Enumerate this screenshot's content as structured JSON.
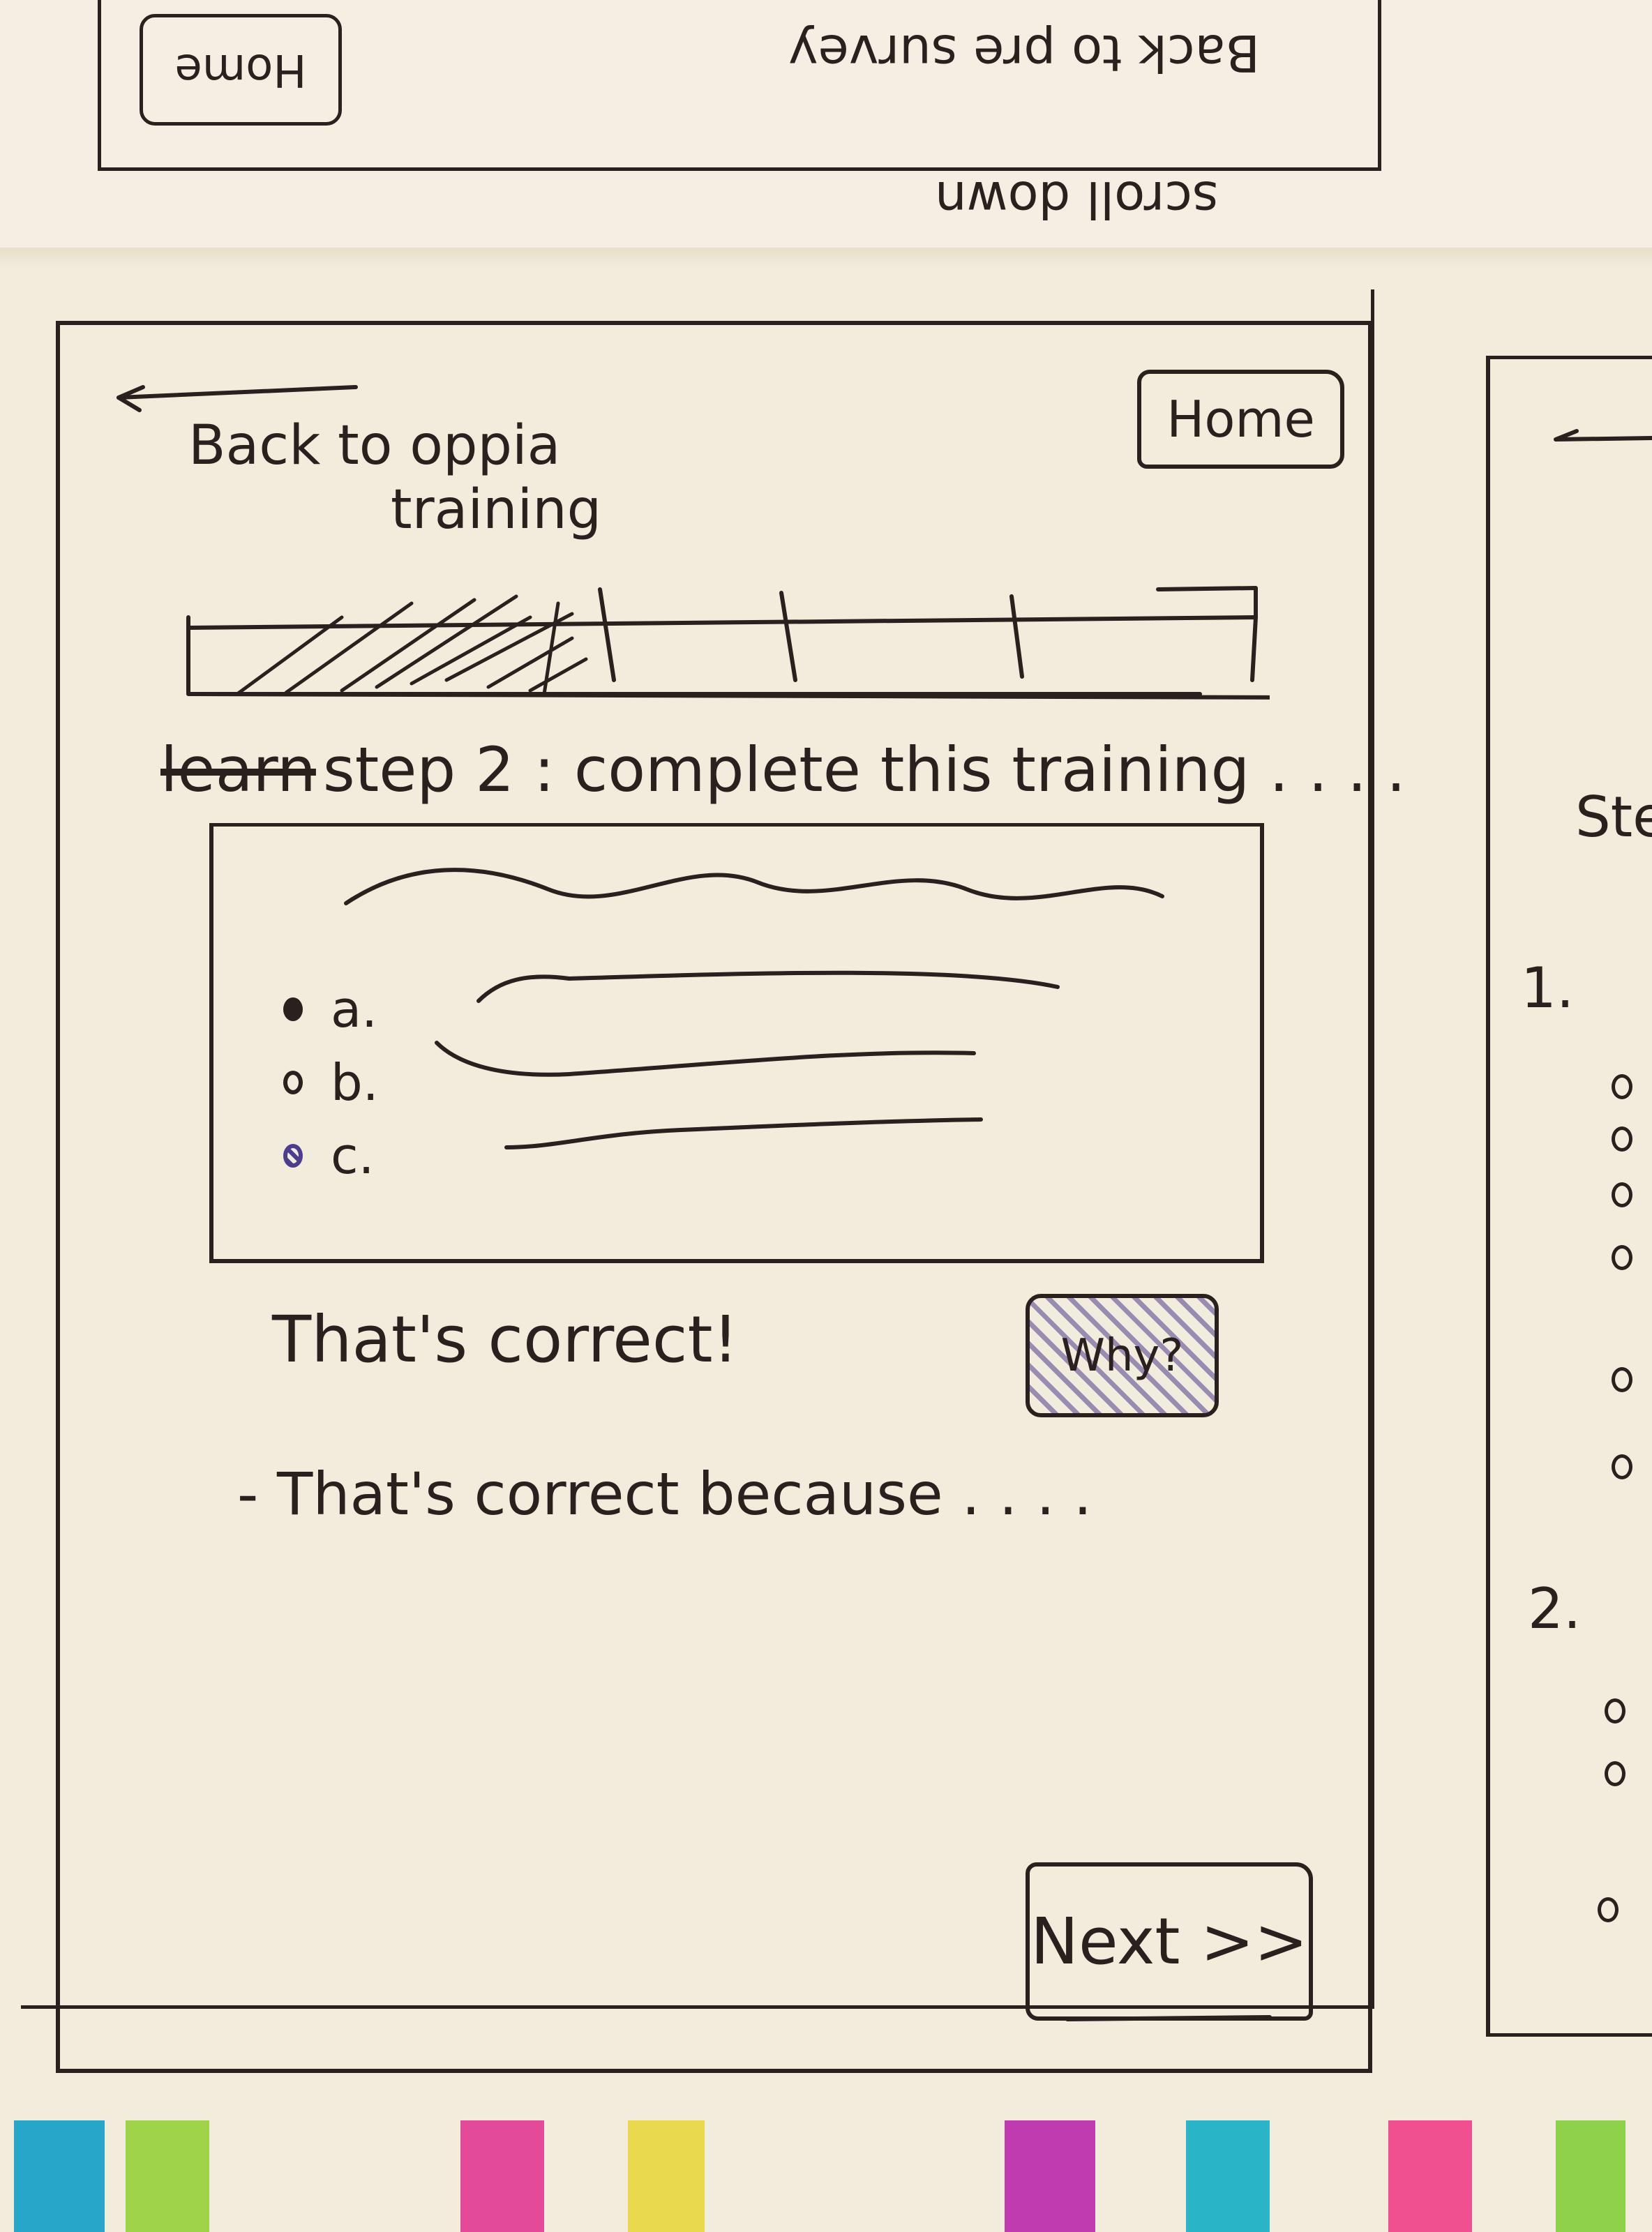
{
  "top_page": {
    "home_label": "Home",
    "back_label": "Back to pre survey",
    "scroll_label": "scroll down"
  },
  "header": {
    "back_line1": "Back to oppia",
    "back_line2": "training",
    "home_label": "Home"
  },
  "progress": {
    "segments": 4,
    "completed_fraction": 0.25
  },
  "step": {
    "struck_word": "learn",
    "title": "step 2 : complete this training . . . ."
  },
  "quiz": {
    "options": [
      {
        "label": "a.",
        "state": "filled"
      },
      {
        "label": "b.",
        "state": "empty"
      },
      {
        "label": "c.",
        "state": "marked"
      }
    ]
  },
  "feedback": {
    "result": "That's correct!",
    "why_label": "Why?",
    "explanation": "- That's correct because . . . ."
  },
  "footer": {
    "next_label": "Next >>"
  },
  "right_sketch": {
    "step_fragment": "Ste",
    "q1": "1.",
    "q2": "2."
  },
  "colors": {
    "ink": "#2a201d",
    "paper": "#f2ecdd",
    "highlight_purple": "#4d3d8f",
    "tab_colors": [
      "#27a6c9",
      "#9ed34a",
      "#e8d94f",
      "#e34b9a",
      "#c03ab0",
      "#2ab4c8",
      "#f04f90",
      "#8fd14a"
    ]
  }
}
